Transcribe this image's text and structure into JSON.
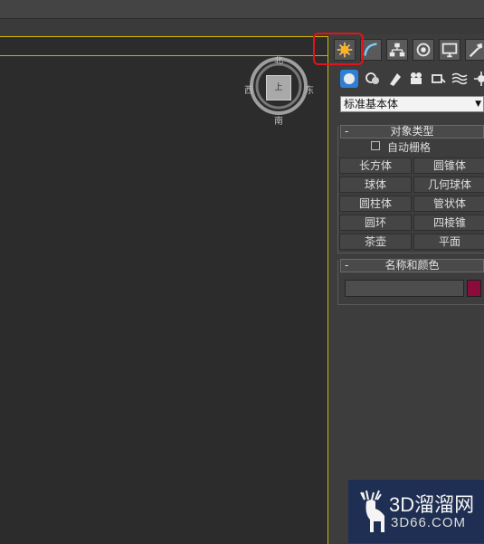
{
  "viewport": {
    "compass": {
      "north": "北",
      "south": "南",
      "west": "西",
      "east": "东"
    },
    "cube_face_label": "上"
  },
  "command_panel": {
    "tabs": [
      {
        "name": "create",
        "icon": "create-star-icon",
        "active": true
      },
      {
        "name": "modify",
        "icon": "modify-arc-icon"
      },
      {
        "name": "hierarchy",
        "icon": "hierarchy-icon"
      },
      {
        "name": "motion",
        "icon": "motion-icon"
      },
      {
        "name": "display",
        "icon": "display-monitor-icon"
      },
      {
        "name": "utilities",
        "icon": "utilities-hammer-icon"
      }
    ],
    "subcategory_icons": [
      "geometry-sphere-icon",
      "shapes-icon",
      "lights-icon",
      "cameras-icon",
      "helpers-icon",
      "space-warps-icon",
      "systems-icon"
    ],
    "dropdown": {
      "value": "标准基本体"
    },
    "object_type": {
      "header": "对象类型",
      "collapse": "-",
      "autogrid_label": "自动栅格",
      "buttons": [
        "长方体",
        "圆锥体",
        "球体",
        "几何球体",
        "圆柱体",
        "管状体",
        "圆环",
        "四棱锥",
        "茶壶",
        "平面"
      ]
    },
    "name_color": {
      "header": "名称和颜色",
      "collapse": "-",
      "name_value": "",
      "swatch_color": "#8a0b3c"
    }
  },
  "watermark": {
    "line1": "3D溜溜网",
    "line2": "3D66.COM"
  },
  "colors": {
    "viewport_border": "#d4b800",
    "highlight": "#e0141a",
    "panel_bg": "#3d3d3d"
  }
}
